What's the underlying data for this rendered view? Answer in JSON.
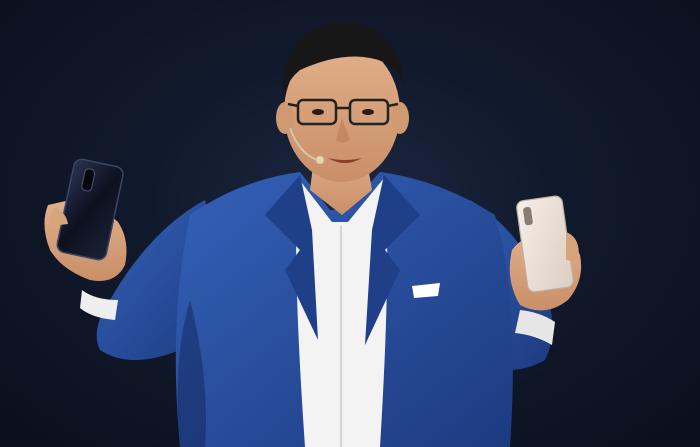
{
  "photo": {
    "subject": "presenter-holding-two-smartphones",
    "colors": {
      "background": "#0b1120",
      "jacket": "#2b52a3",
      "jacket_shadow": "#1b3678",
      "shirt": "#f2f2f2",
      "skin": "#d9a77f",
      "hair": "#1a1a1a",
      "phone_left": "#0f1424",
      "phone_right": "#eadfd6"
    }
  }
}
